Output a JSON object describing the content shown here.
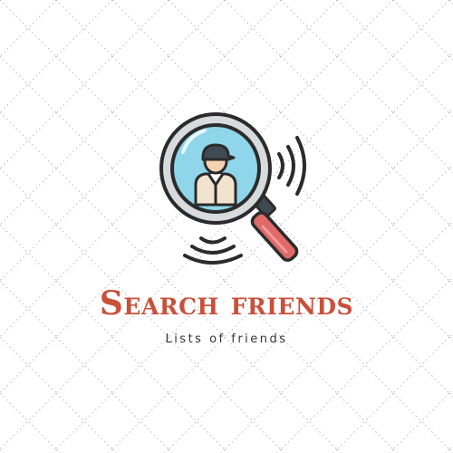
{
  "logo": {
    "icon": "magnifying-glass-person-icon",
    "title": "Search friends",
    "subtitle": "Lists of friends"
  },
  "colors": {
    "title": "#c9503b",
    "subtitle": "#333333",
    "lens_fill": "#8fd6ea",
    "outline": "#2b2b2b",
    "handle": "#e06a6a",
    "face": "#f6d2b0",
    "cap": "#3f4a52",
    "shirt": "#f2e3cf",
    "pattern_dots": "#bdbdbd"
  }
}
